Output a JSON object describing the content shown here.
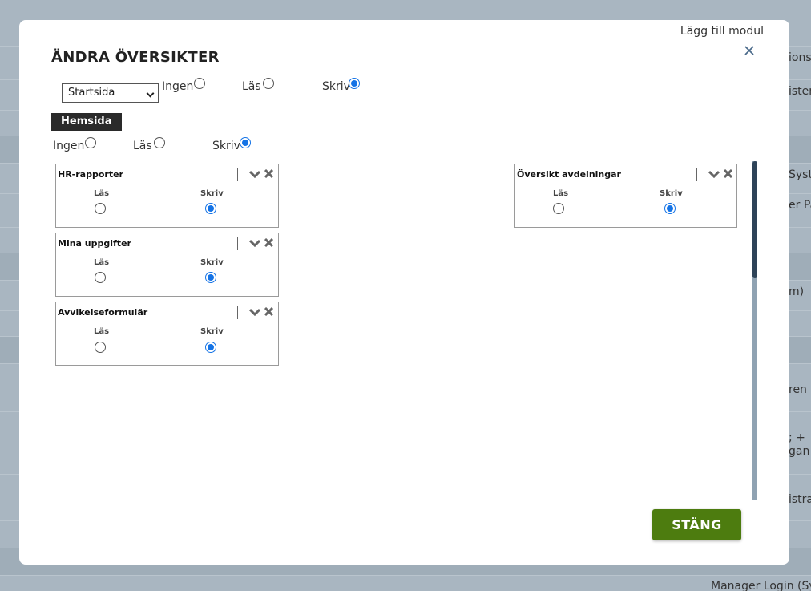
{
  "background": {
    "fragments": [
      "ionsv",
      "istem",
      "Syster",
      "er Pa",
      "m)",
      "ren",
      "; +",
      "gan",
      "istra",
      "Manager Login (Sys"
    ]
  },
  "dialog": {
    "title": "ÄNDRA ÖVERSIKTER",
    "add_module_label": "Lägg till modul",
    "close_icon": "close-icon",
    "select": {
      "value": "Startsida"
    },
    "top_permissions": {
      "options": [
        "Ingen",
        "Läs",
        "Skriv"
      ],
      "selected": "Skriv"
    },
    "section_tag": "Hemsida",
    "section_permissions": {
      "options": [
        "Ingen",
        "Läs",
        "Skriv"
      ],
      "selected": "Skriv"
    },
    "modules": [
      {
        "title": "HR-rapporter",
        "read_label": "Läs",
        "write_label": "Skriv",
        "selected": "Skriv"
      },
      {
        "title": "Mina uppgifter",
        "read_label": "Läs",
        "write_label": "Skriv",
        "selected": "Skriv"
      },
      {
        "title": "Avvikelseformulär",
        "read_label": "Läs",
        "write_label": "Skriv",
        "selected": "Skriv"
      },
      {
        "title": "Översikt avdelningar",
        "read_label": "Läs",
        "write_label": "Skriv",
        "selected": "Skriv"
      }
    ],
    "close_button_label": "STÄNG"
  },
  "colors": {
    "accent": "#1473e6",
    "close_button": "#4d7c0f",
    "tag_background": "#2a2a2a",
    "scroll_thumb": "#2e4358",
    "overlay": "#a9b6c1"
  }
}
